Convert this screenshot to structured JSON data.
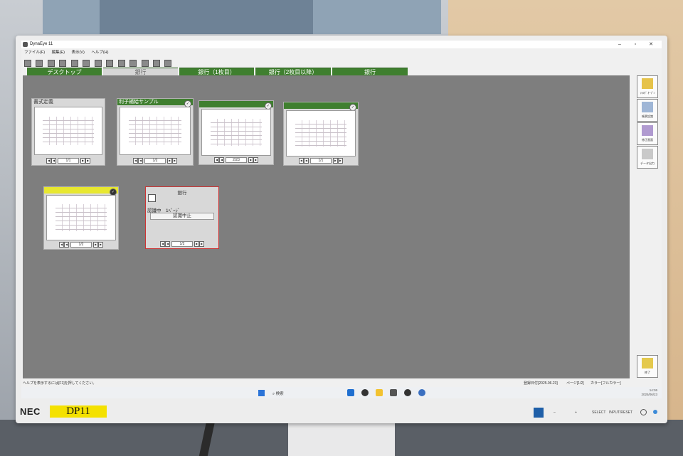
{
  "window": {
    "title": "DynaEye 11"
  },
  "menu": [
    "ファイル(F)",
    "編集(E)",
    "表示(V)",
    "ヘルプ(H)"
  ],
  "tabs": [
    "デスクトップ",
    "銀行",
    "銀行（1枚目）",
    "銀行（2枚目以降）",
    "銀行"
  ],
  "cards": [
    {
      "title": "書式定義",
      "page": "1/1"
    },
    {
      "title": "利子補給サンプル",
      "page": "1/2"
    },
    {
      "title": "",
      "page": "2/23"
    },
    {
      "title": "",
      "page": "1/1"
    },
    {
      "title": "",
      "page": "1/2"
    }
  ],
  "recognition": {
    "title": "銀行",
    "status": "認識中　1ﾍﾟｰｼﾞ",
    "stop_label": "認識中止",
    "page": "1/2"
  },
  "sidebar": [
    {
      "label": "ﾌｫﾙﾀﾞ ｵｰﾌﾟﾝ",
      "icon": "folder-icon"
    },
    {
      "label": "帳票認識",
      "icon": "scan-icon"
    },
    {
      "label": "修正画面",
      "icon": "edit-icon"
    },
    {
      "label": "データ出力",
      "icon": "export-icon"
    },
    {
      "label": "終了",
      "icon": "exit-icon"
    }
  ],
  "statusbar": {
    "help": "ヘルプを表示するには[F1]を押してください。",
    "date": "登録日付[2025.06.23]",
    "page": "ページ[1/2]",
    "color": "カラー[フルカラー]"
  },
  "taskbar": {
    "search": "検索",
    "time": "14:36",
    "date": "2025/06/23"
  },
  "monitor": {
    "brand": "NEC",
    "label": "DP11",
    "buttons": [
      "–",
      "+",
      "SELECT",
      "INPUT/RESET"
    ]
  }
}
